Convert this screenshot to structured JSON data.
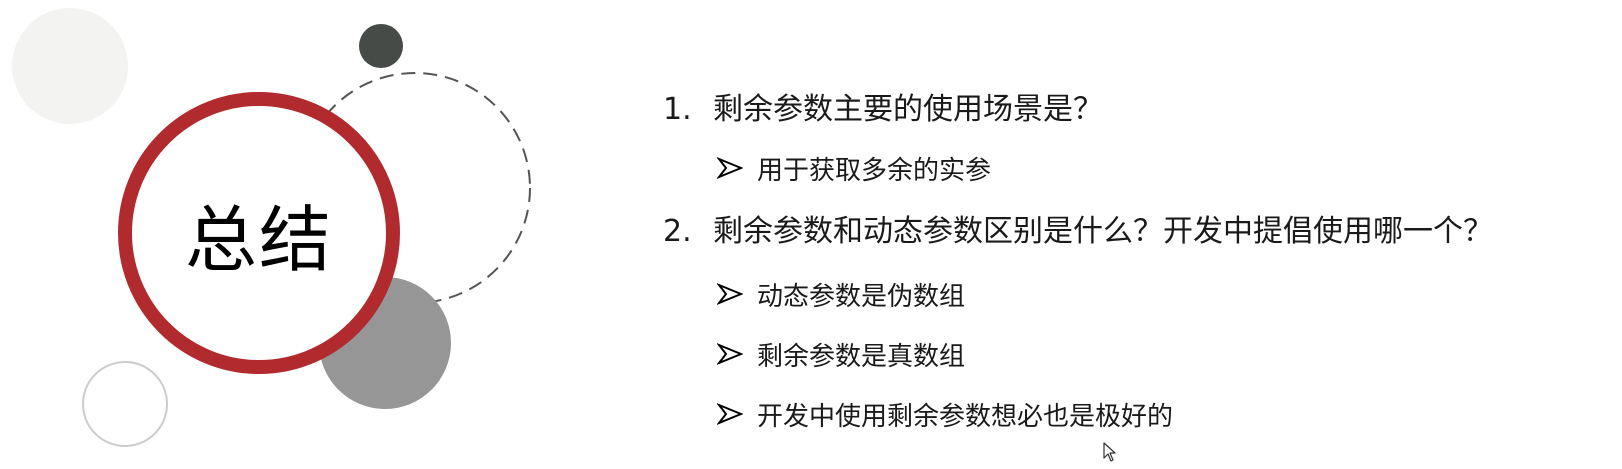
{
  "slide": {
    "title": "总结"
  },
  "questions": [
    {
      "number": "1.",
      "text": "剩余参数主要的使用场景是？",
      "answers": [
        "用于获取多余的实参"
      ]
    },
    {
      "number": "2.",
      "text": "剩余参数和动态参数区别是什么？开发中提倡使用哪一个？",
      "answers": [
        "动态参数是伪数组",
        "剩余参数是真数组",
        "开发中使用剩余参数想必也是极好的"
      ]
    }
  ],
  "icons": {
    "bullet": "arrowhead-bullet-icon",
    "cursor": "mouse-pointer-icon"
  },
  "colors": {
    "accent_ring": "#b02a2e",
    "dark_circle": "#464b48",
    "gray_circle": "#969696",
    "light_circle": "#f3f3f2",
    "dashed_ring": "#555555"
  }
}
